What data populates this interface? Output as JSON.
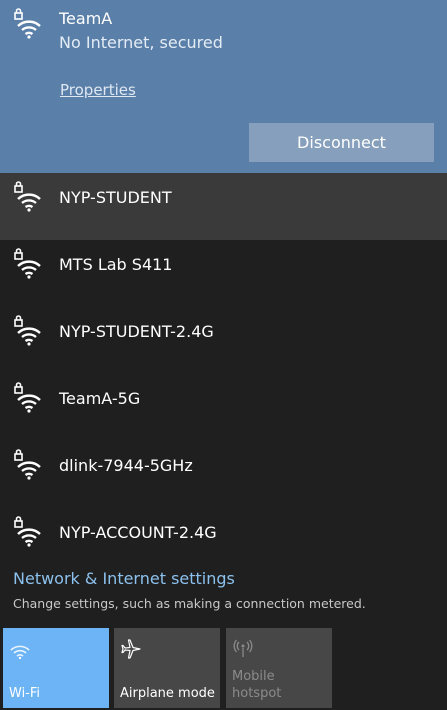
{
  "connected": {
    "name": "TeamA",
    "status": "No Internet, secured",
    "properties_label": "Properties",
    "disconnect_label": "Disconnect"
  },
  "networks": [
    {
      "name": "NYP-STUDENT"
    },
    {
      "name": "MTS Lab S411"
    },
    {
      "name": "NYP-STUDENT-2.4G"
    },
    {
      "name": "TeamA-5G"
    },
    {
      "name": "dlink-7944-5GHz"
    },
    {
      "name": "NYP-ACCOUNT-2.4G"
    }
  ],
  "settings": {
    "title": "Network & Internet settings",
    "description": "Change settings, such as making a connection metered."
  },
  "quick_actions": {
    "wifi": {
      "label": "Wi-Fi",
      "state": "on"
    },
    "airplane": {
      "label": "Airplane mode",
      "state": "off"
    },
    "hotspot": {
      "label_line1": "Mobile",
      "label_line2": "hotspot",
      "state": "disabled"
    }
  },
  "colors": {
    "connected_bg": "#5a7fa8",
    "panel_bg": "#1f1f1f",
    "accent": "#6cb4f5",
    "link": "#8cc1ee"
  },
  "icons": {
    "secured_wifi": "secured-wifi-icon",
    "airplane": "airplane-icon",
    "hotspot": "hotspot-icon",
    "wifi": "wifi-icon"
  }
}
